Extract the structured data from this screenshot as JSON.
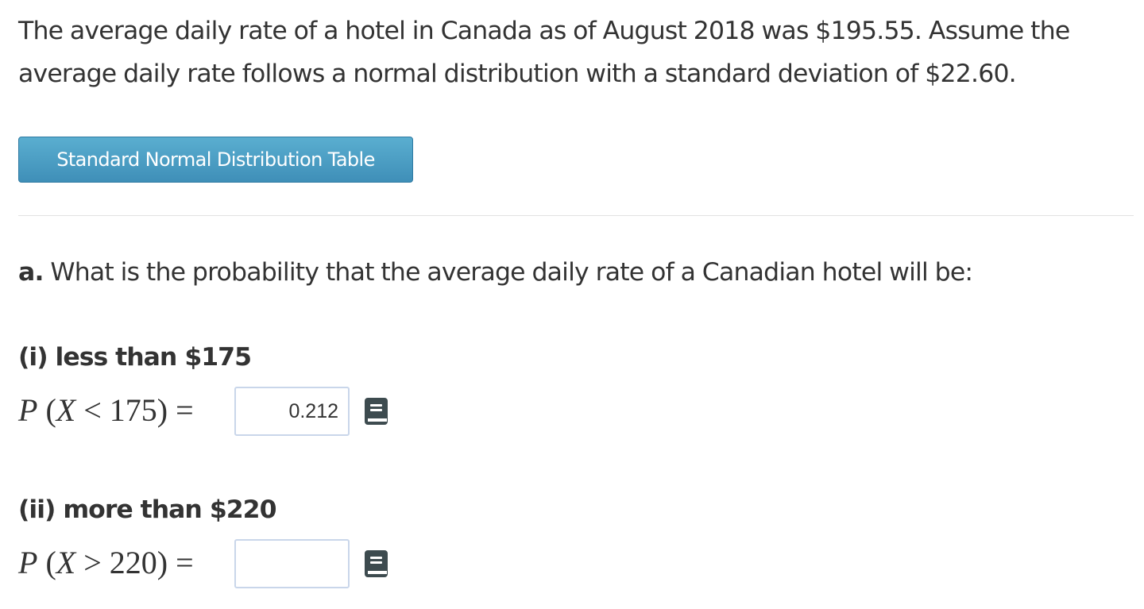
{
  "intro": {
    "text": "The average daily rate of a hotel in Canada as of August 2018 was $195.55. Assume the average daily rate follows a normal distribution with a standard deviation of $22.60."
  },
  "table_button": {
    "label": "Standard Normal Distribution Table"
  },
  "question": {
    "label": "a.",
    "text": "What is the probability that the average daily rate of a Canadian hotel will be:"
  },
  "parts": [
    {
      "heading": "(i) less than $175",
      "eq_prefix": "P",
      "eq_open": " (",
      "eq_var": "X",
      "eq_rest": " < 175) =",
      "value": "0.212",
      "icon": "book-icon"
    },
    {
      "heading": "(ii) more than $220",
      "eq_prefix": "P",
      "eq_open": " (",
      "eq_var": "X",
      "eq_rest": " > 220) =",
      "value": "",
      "icon": "book-icon"
    }
  ],
  "colors": {
    "text": "#333333",
    "button_bg": "#4a9dc4",
    "input_border": "#c9d6ea",
    "icon": "#3d4b4f"
  }
}
